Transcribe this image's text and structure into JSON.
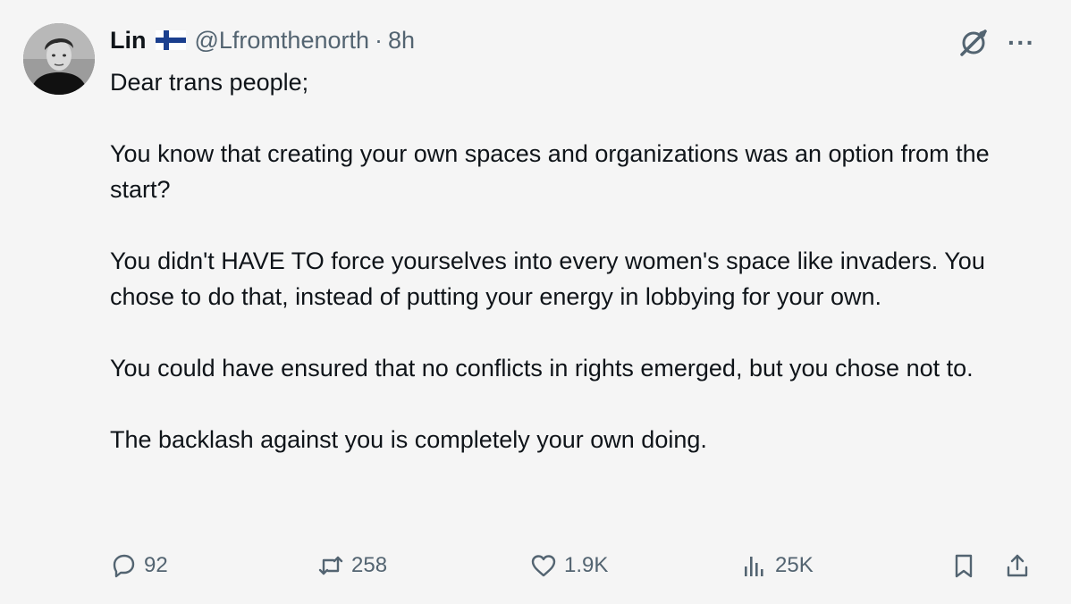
{
  "author": {
    "name": "Lin",
    "flag_icon": "finland-flag-icon",
    "handle": "@Lfromthenorth",
    "separator": "·",
    "time": "8h"
  },
  "tweet": {
    "paragraphs": [
      "Dear trans people;",
      "You know that creating your own spaces and organizations was an option from the start?",
      "You didn't HAVE TO force yourselves into every women's space like invaders. You chose to do that, instead of putting your energy in lobbying for your own.",
      "You could have ensured that no conflicts in rights emerged, but you chose not to.",
      "The backlash against you is completely your own doing."
    ]
  },
  "top_actions": {
    "grok_icon": "grok-icon",
    "more_label": "···"
  },
  "actions": {
    "reply_count": "92",
    "retweet_count": "258",
    "like_count": "1.9K",
    "views_count": "25K"
  },
  "colors": {
    "background": "#f5f5f5",
    "text": "#0f1419",
    "secondary": "#536471",
    "flag_blue": "#1b3f8e"
  }
}
